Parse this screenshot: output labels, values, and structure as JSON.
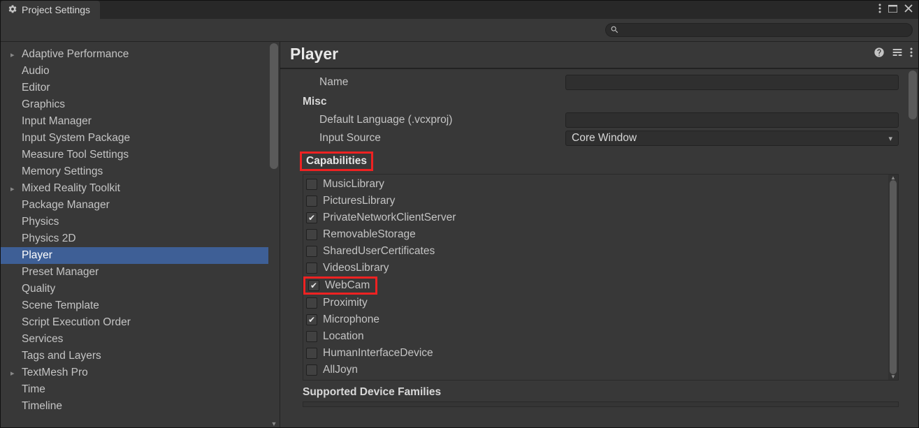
{
  "window": {
    "title": "Project Settings"
  },
  "search": {
    "placeholder": ""
  },
  "sidebar": {
    "items": [
      {
        "label": "Adaptive Performance",
        "expandable": true
      },
      {
        "label": "Audio"
      },
      {
        "label": "Editor"
      },
      {
        "label": "Graphics"
      },
      {
        "label": "Input Manager"
      },
      {
        "label": "Input System Package"
      },
      {
        "label": "Measure Tool Settings"
      },
      {
        "label": "Memory Settings"
      },
      {
        "label": "Mixed Reality Toolkit",
        "expandable": true
      },
      {
        "label": "Package Manager"
      },
      {
        "label": "Physics"
      },
      {
        "label": "Physics 2D"
      },
      {
        "label": "Player",
        "selected": true
      },
      {
        "label": "Preset Manager"
      },
      {
        "label": "Quality"
      },
      {
        "label": "Scene Template"
      },
      {
        "label": "Script Execution Order"
      },
      {
        "label": "Services"
      },
      {
        "label": "Tags and Layers"
      },
      {
        "label": "TextMesh Pro",
        "expandable": true
      },
      {
        "label": "Time"
      },
      {
        "label": "Timeline"
      }
    ]
  },
  "panel": {
    "title": "Player"
  },
  "form": {
    "name_label": "Name",
    "name_value": "",
    "misc_label": "Misc",
    "default_lang_label": "Default Language (.vcxproj)",
    "default_lang_value": "",
    "input_source_label": "Input Source",
    "input_source_value": "Core Window"
  },
  "capabilities": {
    "label": "Capabilities",
    "items": [
      {
        "name": "MusicLibrary",
        "checked": false
      },
      {
        "name": "PicturesLibrary",
        "checked": false
      },
      {
        "name": "PrivateNetworkClientServer",
        "checked": true
      },
      {
        "name": "RemovableStorage",
        "checked": false
      },
      {
        "name": "SharedUserCertificates",
        "checked": false
      },
      {
        "name": "VideosLibrary",
        "checked": false
      },
      {
        "name": "WebCam",
        "checked": true,
        "highlight": true
      },
      {
        "name": "Proximity",
        "checked": false
      },
      {
        "name": "Microphone",
        "checked": true
      },
      {
        "name": "Location",
        "checked": false
      },
      {
        "name": "HumanInterfaceDevice",
        "checked": false
      },
      {
        "name": "AllJoyn",
        "checked": false
      }
    ]
  },
  "supported": {
    "label": "Supported Device Families"
  }
}
